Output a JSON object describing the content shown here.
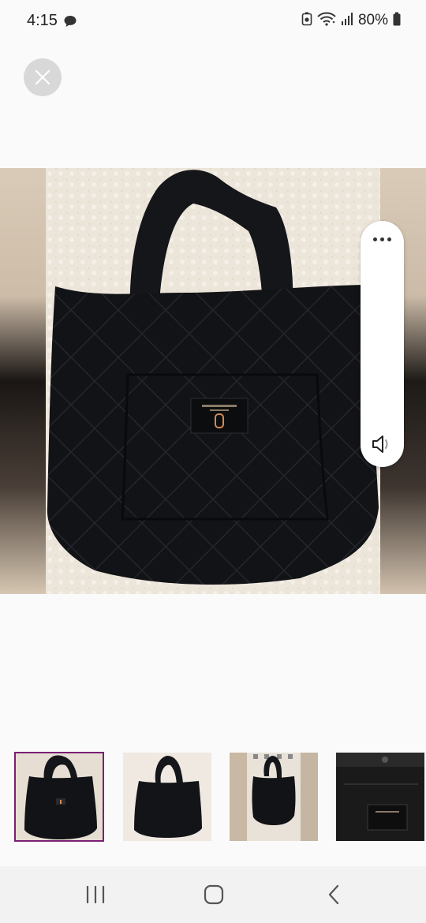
{
  "status_bar": {
    "time": "4:15",
    "battery_text": "80%",
    "icons": [
      "chat-bubble-icon",
      "battery-saver-icon",
      "wifi-icon",
      "signal-icon",
      "battery-icon"
    ]
  },
  "viewer": {
    "close_icon": "close-icon",
    "volume_panel": {
      "more_icon": "more-options-icon",
      "speaker_icon": "speaker-icon"
    },
    "thumbnail_count": 4,
    "selected_thumbnail": 1
  },
  "navigation": {
    "icons": [
      "recent-apps-icon",
      "home-icon",
      "back-icon"
    ]
  },
  "colors": {
    "background": "#fafafa",
    "selection_outline": "#7b1f74",
    "close_button_bg": "#d8d8d8",
    "nav_bar_bg": "#f2f2f2"
  }
}
